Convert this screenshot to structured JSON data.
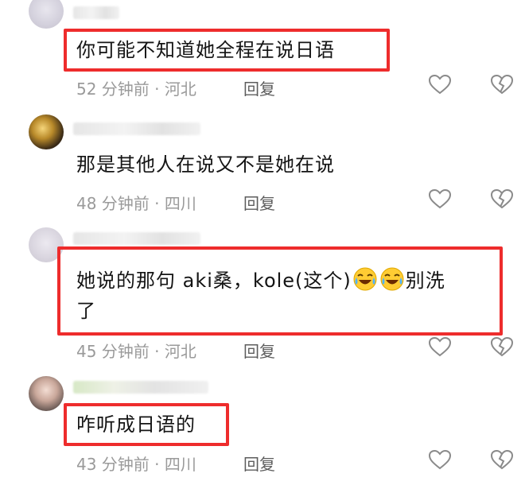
{
  "comments": [
    {
      "text": "你可能不知道她全程在说日语",
      "time": "52 分钟前",
      "location": "河北",
      "reply": "回复",
      "highlighted": true
    },
    {
      "text": "那是其他人在说又不是她在说",
      "time": "48 分钟前",
      "location": "四川",
      "reply": "回复",
      "highlighted": false
    },
    {
      "text_part1": "她说的那句  aki桑，kole(这个)",
      "text_part2": "别洗",
      "text_line2": "了",
      "emoji": "laughing-crying-face",
      "time": "45 分钟前",
      "location": "河北",
      "reply": "回复",
      "highlighted": true
    },
    {
      "text": "咋听成日语的",
      "time": "43 分钟前",
      "location": "四川",
      "reply": "回复",
      "highlighted": true
    }
  ],
  "separator": "·",
  "colors": {
    "highlight": "#ee2c2c",
    "meta": "#9a9a9a",
    "text": "#141414",
    "reply": "#5d5d5d"
  }
}
